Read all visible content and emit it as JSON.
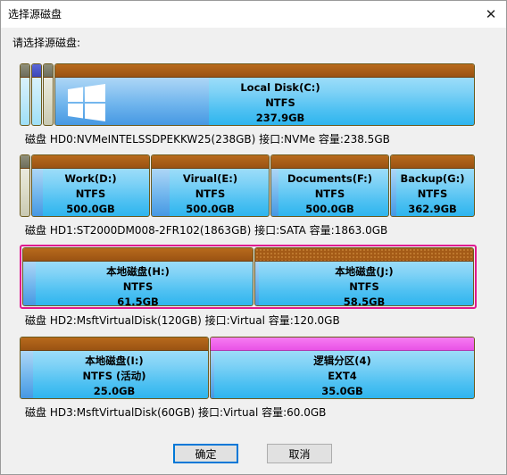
{
  "window": {
    "title": "选择源磁盘",
    "close_glyph": "✕"
  },
  "prompt": "请选择源磁盘:",
  "disks": [
    {
      "label": "磁盘 HD0:NVMeINTELSSDPEKKW25(238GB)  接口:NVMe  容量:238.5GB",
      "partitions": [
        {
          "name": "",
          "fs": "",
          "size": ""
        },
        {
          "name": "",
          "fs": "",
          "size": ""
        },
        {
          "name": "",
          "fs": "",
          "size": ""
        },
        {
          "name": "Local Disk(C:)",
          "fs": "NTFS",
          "size": "237.9GB",
          "icon": "windows-logo-icon"
        }
      ]
    },
    {
      "label": "磁盘 HD1:ST2000DM008-2FR102(1863GB)  接口:SATA  容量:1863.0GB",
      "partitions": [
        {
          "name": "",
          "fs": "",
          "size": ""
        },
        {
          "name": "Work(D:)",
          "fs": "NTFS",
          "size": "500.0GB"
        },
        {
          "name": "Virual(E:)",
          "fs": "NTFS",
          "size": "500.0GB"
        },
        {
          "name": "Documents(F:)",
          "fs": "NTFS",
          "size": "500.0GB"
        },
        {
          "name": "Backup(G:)",
          "fs": "NTFS",
          "size": "362.9GB"
        }
      ]
    },
    {
      "label": "磁盘 HD2:MsftVirtualDisk(120GB)  接口:Virtual  容量:120.0GB",
      "selected": true,
      "partitions": [
        {
          "name": "本地磁盘(H:)",
          "fs": "NTFS",
          "size": "61.5GB"
        },
        {
          "name": "本地磁盘(J:)",
          "fs": "NTFS",
          "size": "58.5GB"
        }
      ]
    },
    {
      "label": "磁盘 HD3:MsftVirtualDisk(60GB)  接口:Virtual  容量:60.0GB",
      "partitions": [
        {
          "name": "本地磁盘(I:)",
          "fs": "NTFS (活动)",
          "size": "25.0GB"
        },
        {
          "name": "逻辑分区(4)",
          "fs": "EXT4",
          "size": "35.0GB"
        }
      ]
    }
  ],
  "buttons": {
    "ok": "确定",
    "cancel": "取消"
  },
  "colors": {
    "selection": "#e0178f",
    "accent": "#0078d7"
  }
}
